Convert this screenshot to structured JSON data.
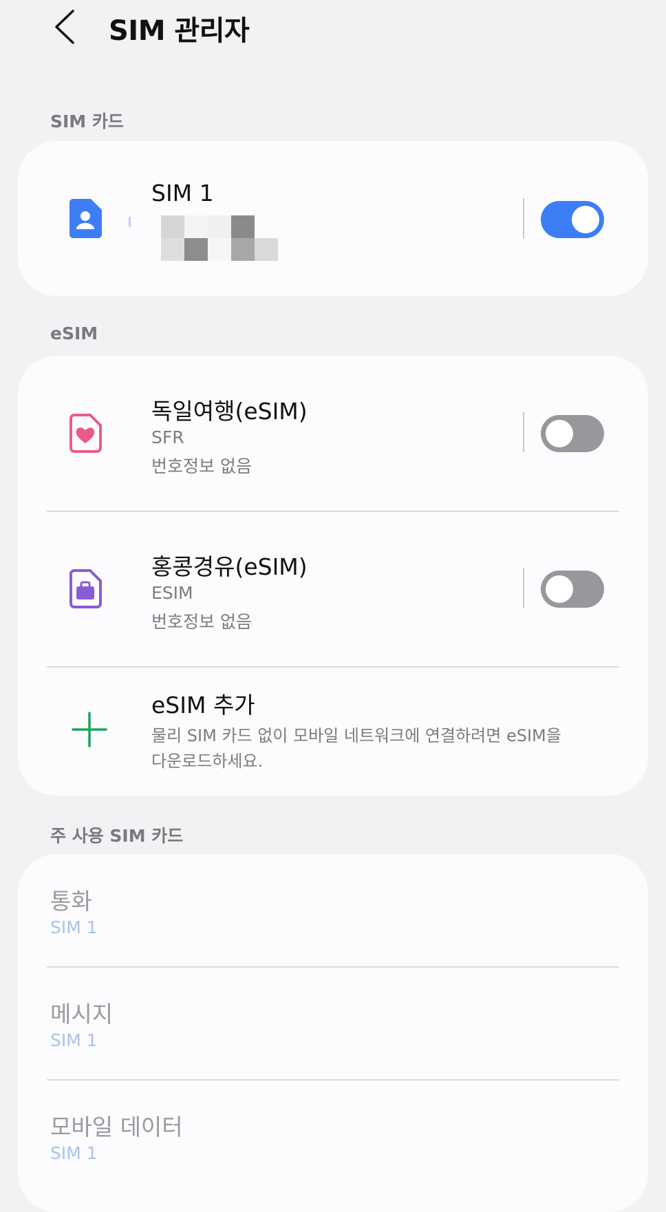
{
  "header": {
    "title": "SIM 관리자"
  },
  "sections": {
    "sim_card_label": "SIM 카드",
    "esim_label": "eSIM",
    "primary_label": "주 사용 SIM 카드"
  },
  "sim_card": {
    "name": "SIM 1",
    "enabled": true
  },
  "esims": [
    {
      "name": "독일여행(eSIM)",
      "carrier": "SFR",
      "number": "번호정보 없음",
      "enabled": false,
      "icon": "heart-sim-icon",
      "color": "#ea5b8a"
    },
    {
      "name": "홍콩경유(eSIM)",
      "carrier": "ESIM",
      "number": "번호정보 없음",
      "enabled": false,
      "icon": "briefcase-sim-icon",
      "color": "#8a5bd4"
    }
  ],
  "add_esim": {
    "title": "eSIM 추가",
    "description_line1": "물리 SIM 카드 없이 모바일 네트워크에 연결하려면 eSIM을",
    "description_line2": "다운로드하세요.",
    "icon": "plus-icon",
    "color": "#1aa35a"
  },
  "primary": [
    {
      "title": "통화",
      "value": "SIM 1"
    },
    {
      "title": "메시지",
      "value": "SIM 1"
    },
    {
      "title": "모바일 데이터",
      "value": "SIM 1"
    }
  ],
  "colors": {
    "toggle_on": "#3d7ef7",
    "toggle_off": "#98989c",
    "sim_icon": "#3d7ef7"
  }
}
